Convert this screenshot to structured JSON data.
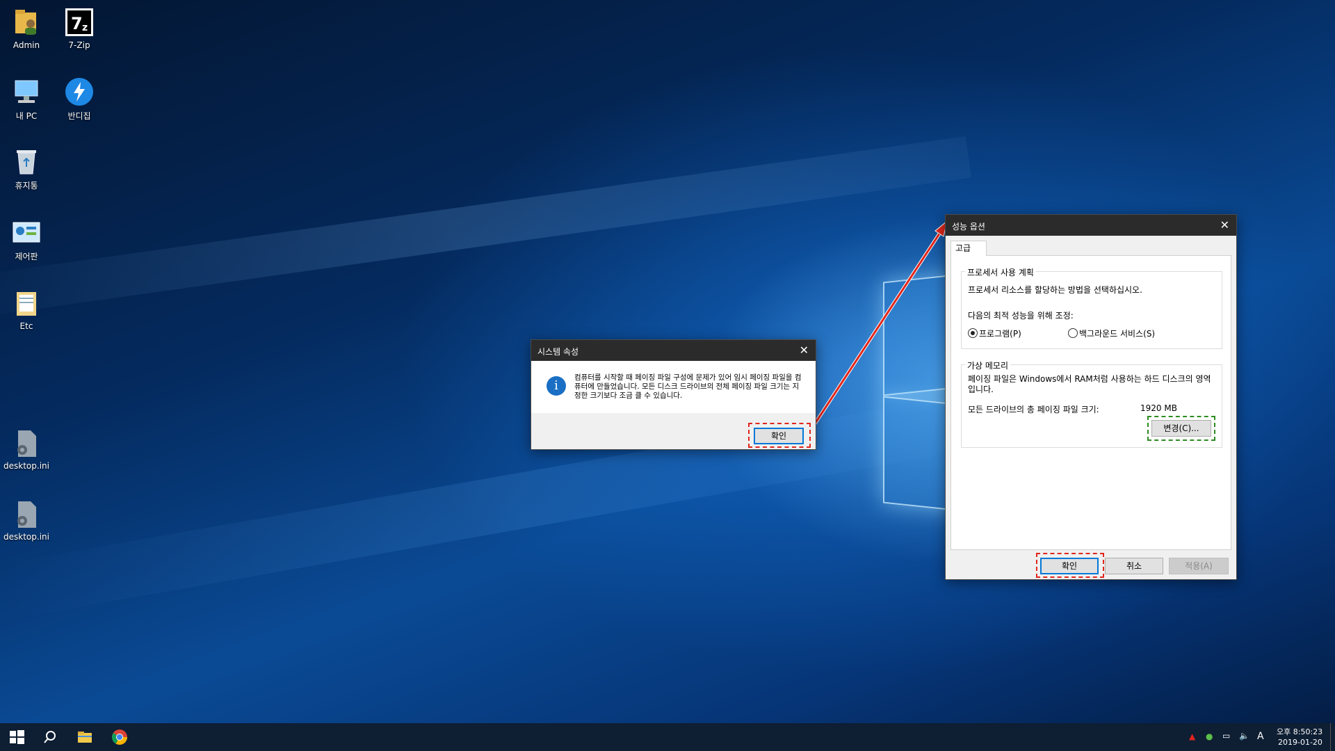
{
  "desktop": {
    "icons": [
      {
        "label": "Admin",
        "icon": "user-folder-icon"
      },
      {
        "label": "7-Zip",
        "icon": "seven-zip-icon"
      },
      {
        "label": "내 PC",
        "icon": "computer-icon"
      },
      {
        "label": "반디집",
        "icon": "bandizip-icon"
      },
      {
        "label": "휴지통",
        "icon": "recycle-bin-icon"
      },
      {
        "label": "제어판",
        "icon": "control-panel-icon"
      },
      {
        "label": "Etc",
        "icon": "folder-icon"
      },
      {
        "label": "desktop.ini",
        "icon": "settings-file-icon"
      },
      {
        "label": "desktop.ini",
        "icon": "settings-file-icon"
      }
    ]
  },
  "system_dialog": {
    "title": "시스템 속성",
    "message": "컴퓨터를 시작할 때 페이징 파일 구성에 문제가 있어 임시 페이징 파일을 컴퓨터에 만들었습니다. 모든 디스크 드라이브의 전체 페이징 파일 크기는 지정한 크기보다 조금 클 수 있습니다.",
    "ok_label": "확인"
  },
  "perf_dialog": {
    "title": "성능 옵션",
    "tab": "고급",
    "processor": {
      "group_title": "프로세서 사용 계획",
      "description": "프로세서 리소스를 할당하는 방법을 선택하십시오.",
      "adjust_label": "다음의 최적 성능을 위해 조정:",
      "option_programs": "프로그램(P)",
      "option_background": "백그라운드 서비스(S)",
      "selected": "programs"
    },
    "virtual_memory": {
      "group_title": "가상 메모리",
      "description": "페이징 파일은 Windows에서 RAM처럼 사용하는 하드 디스크의 영역입니다.",
      "total_label": "모든 드라이브의 총 페이징 파일 크기:",
      "total_value": "1920 MB",
      "change_label": "변경(C)..."
    },
    "ok_label": "확인",
    "cancel_label": "취소",
    "apply_label": "적용(A)"
  },
  "taskbar": {
    "clock_time": "오후 8:50:23",
    "clock_date": "2019-01-20",
    "ime": "A"
  },
  "colors": {
    "annotation_red": "#e1261c",
    "annotation_green": "#2e8b22",
    "accent": "#0078d7"
  }
}
